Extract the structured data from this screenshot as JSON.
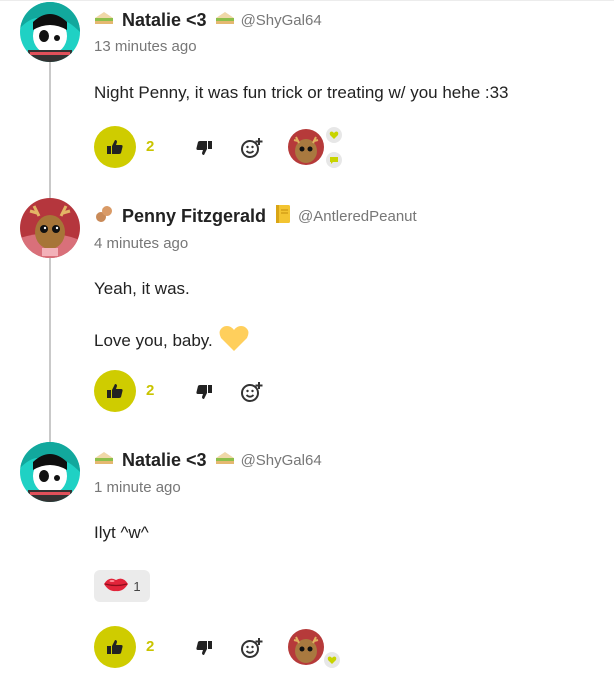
{
  "comments": [
    {
      "name": "Natalie <3",
      "handle": "@ShyGal64",
      "time": "13 minutes ago",
      "lines": [
        "Night Penny, it was fun trick or treating w/ you hehe :33"
      ],
      "likes": "2",
      "prefix_icon": "sandwich-icon",
      "suffix_icon": "sandwich-icon"
    },
    {
      "name": "Penny Fitzgerald",
      "handle": "@AntleredPeanut",
      "time": "4 minutes ago",
      "lines": [
        "Yeah, it was.",
        "Love you, baby."
      ],
      "likes": "2",
      "prefix_icon": "peanut-icon",
      "suffix_icon": "notebook-icon"
    },
    {
      "name": "Natalie <3",
      "handle": "@ShyGal64",
      "time": "1 minute ago",
      "lines": [
        "Ilyt ^w^"
      ],
      "likes": "2",
      "prefix_icon": "sandwich-icon",
      "suffix_icon": "sandwich-icon",
      "reaction_chip": {
        "icon": "lips-icon",
        "count": "1"
      }
    }
  ],
  "colors": {
    "accent": "#cfcc00",
    "like_count": "#c9c400",
    "heart": "#ffcf5c",
    "badge_heart": "#c8d400"
  }
}
